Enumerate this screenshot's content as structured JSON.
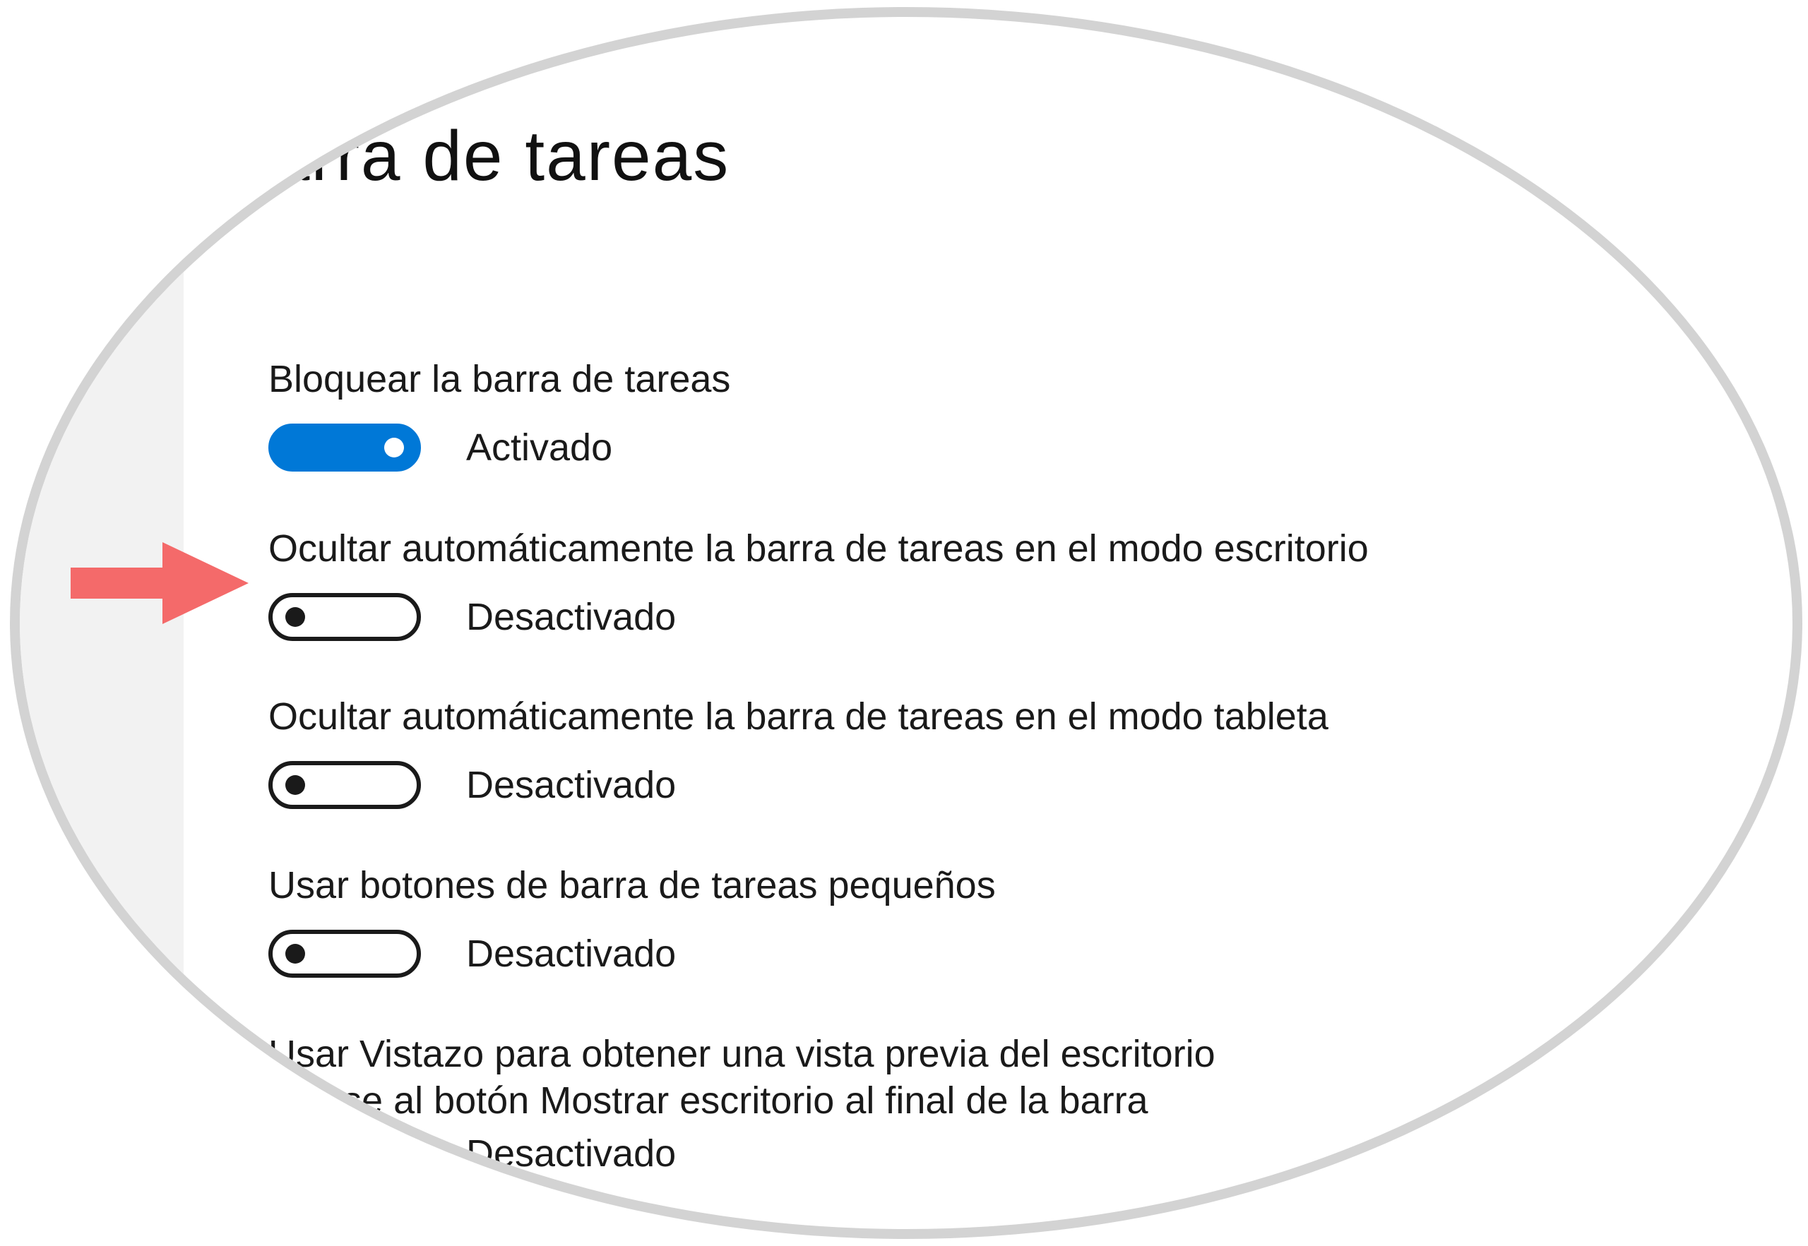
{
  "page": {
    "title": "Barra de tareas"
  },
  "settings": [
    {
      "label": "Bloquear la barra de tareas",
      "state": "Activado",
      "on": true
    },
    {
      "label": "Ocultar automáticamente la barra de tareas en el modo escritorio",
      "state": "Desactivado",
      "on": false
    },
    {
      "label": "Ocultar automáticamente la barra de tareas en el modo tableta",
      "state": "Desactivado",
      "on": false
    },
    {
      "label": "Usar botones de barra de tareas pequeños",
      "state": "Desactivado",
      "on": false
    },
    {
      "label_line1": "Usar Vistazo para obtener una vista previa del escritorio",
      "label_line2": "mouse al botón Mostrar escritorio al final de la barra",
      "state": "Desactivado",
      "on": false
    }
  ],
  "colors": {
    "accent": "#0078d7",
    "annotation_arrow": "#f46a6a",
    "lens_border": "#d3d3d3"
  },
  "icons": {
    "annotation": "right-arrow-icon"
  }
}
